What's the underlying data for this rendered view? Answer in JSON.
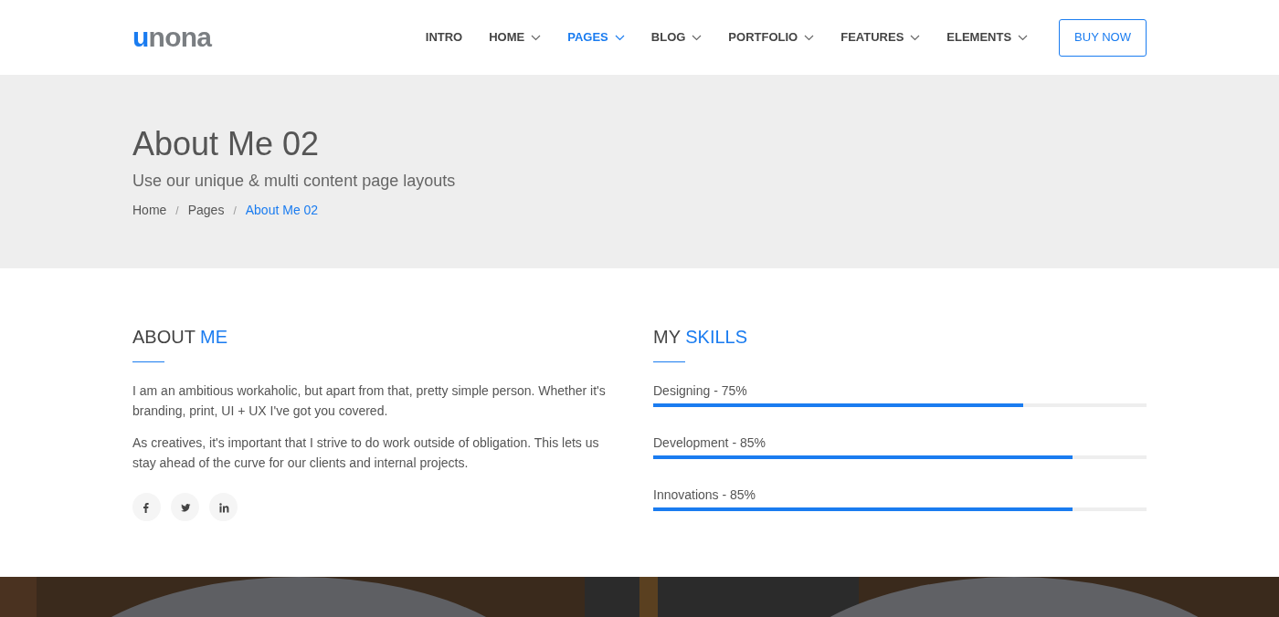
{
  "header": {
    "logo": {
      "accent": "u",
      "rest": "nona"
    },
    "nav": [
      {
        "label": "INTRO",
        "dropdown": false,
        "selected": false
      },
      {
        "label": "HOME",
        "dropdown": true,
        "selected": false
      },
      {
        "label": "PAGES",
        "dropdown": true,
        "selected": true
      },
      {
        "label": "BLOG",
        "dropdown": true,
        "selected": false
      },
      {
        "label": "PORTFOLIO",
        "dropdown": true,
        "selected": false
      },
      {
        "label": "FEATURES",
        "dropdown": true,
        "selected": false
      },
      {
        "label": "ELEMENTS",
        "dropdown": true,
        "selected": false
      }
    ],
    "button": "BUY NOW"
  },
  "hero": {
    "title": "About Me 02",
    "subtitle": "Use our unique & multi content page layouts",
    "breadcrumb": [
      {
        "label": "Home",
        "selected": false
      },
      {
        "label": "Pages",
        "selected": false
      },
      {
        "label": "About Me 02",
        "selected": true
      }
    ],
    "separator": "/"
  },
  "about": {
    "heading": {
      "plain": "ABOUT ",
      "accent": "ME"
    },
    "paragraphs": [
      "I am an ambitious workaholic, but apart from that, pretty simple person. Whether it's branding, print, UI + UX I've got you covered.",
      "As creatives, it's important that I strive to do work outside of obligation. This lets us stay ahead of the curve for our clients and internal projects."
    ],
    "social": [
      {
        "kind": "facebook"
      },
      {
        "kind": "twitter"
      },
      {
        "kind": "linkedin"
      }
    ]
  },
  "skills": {
    "heading": {
      "plain": "MY ",
      "accent": "SKILLS"
    },
    "items": [
      {
        "label": "Designing - 75%",
        "level": 0.75
      },
      {
        "label": "Development - 85%",
        "level": 0.85
      },
      {
        "label": "Innovations - 85%",
        "level": 0.85
      }
    ]
  }
}
